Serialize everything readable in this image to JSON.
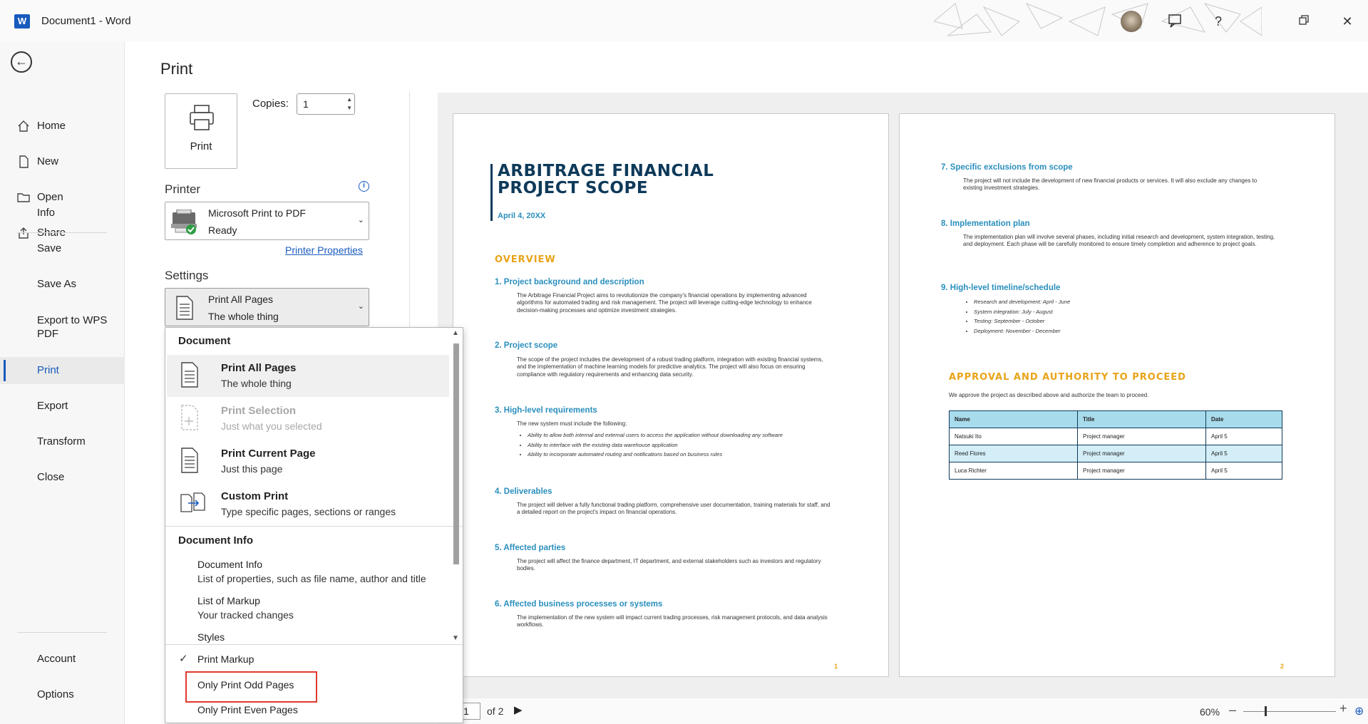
{
  "window": {
    "app_letter": "W",
    "title": "Document1  -  Word",
    "help_label": "?",
    "close_label": "✕"
  },
  "nav": {
    "back_icon": "back-arrow-icon",
    "top_items": [
      {
        "label": "Home",
        "icon": "home-icon"
      },
      {
        "label": "New",
        "icon": "new-doc-icon"
      },
      {
        "label": "Open",
        "icon": "folder-icon"
      },
      {
        "label": "Share",
        "icon": "share-icon"
      }
    ],
    "mid_items": [
      "Info",
      "Save",
      "Save As",
      "Export to WPS PDF",
      "Print",
      "Export",
      "Transform",
      "Close"
    ],
    "active": "Print",
    "bottom_items": [
      "Account",
      "Options"
    ]
  },
  "print": {
    "heading": "Print",
    "print_button": "Print",
    "copies_label": "Copies:",
    "copies_value": "1",
    "printer_section": "Printer",
    "printer_name": "Microsoft Print to PDF",
    "printer_status": "Ready",
    "printer_properties": "Printer Properties",
    "settings_section": "Settings",
    "settings_value": "Print All Pages",
    "settings_sub": "The whole thing"
  },
  "dropdown": {
    "document_header": "Document",
    "options": [
      {
        "title": "Print All Pages",
        "sub": "The whole thing",
        "selected": true,
        "disabled": false
      },
      {
        "title": "Print Selection",
        "sub": "Just what you selected",
        "selected": false,
        "disabled": true
      },
      {
        "title": "Print Current Page",
        "sub": "Just this page",
        "selected": false,
        "disabled": false
      },
      {
        "title": "Custom Print",
        "sub": "Type specific pages, sections or ranges",
        "selected": false,
        "disabled": false
      }
    ],
    "info_header": "Document Info",
    "info_items": [
      {
        "title": "Document Info",
        "sub": "List of properties, such as file name, author and title"
      },
      {
        "title": "List of Markup",
        "sub": "Your tracked changes"
      },
      {
        "title": "Styles",
        "sub": ""
      }
    ],
    "toggles": [
      {
        "label": "Print Markup",
        "checked": true
      },
      {
        "label": "Only Print Odd Pages",
        "checked": false
      },
      {
        "label": "Only Print Even Pages",
        "checked": false
      }
    ]
  },
  "preview": {
    "page1": {
      "title_line1": "ARBITRAGE FINANCIAL",
      "title_line2": "PROJECT SCOPE",
      "date": "April 4, 20XX",
      "overview": "OVERVIEW",
      "items": [
        {
          "heading": "1.  Project background and description",
          "text": "The Arbitrage Financial Project aims to revolutionize the company's financial operations by implementing advanced algorithms for automated trading and risk management. The project will leverage cutting-edge technology to enhance decision-making processes and optimize investment strategies."
        },
        {
          "heading": "2.  Project scope",
          "text": "The scope of the project includes the development of a robust trading platform, integration with existing financial systems, and the implementation of machine learning models for predictive analytics. The project will also focus on ensuring compliance with regulatory requirements and enhancing data security."
        },
        {
          "heading": "3.  High-level requirements",
          "text": "The new system must include the following:"
        },
        {
          "heading": "4.  Deliverables",
          "text": "The project will deliver a fully functional trading platform, comprehensive user documentation, training materials for staff, and a detailed report on the project's impact on financial operations."
        },
        {
          "heading": "5.   Affected parties",
          "text": "The project will affect the finance department, IT department, and external stakeholders such as investors and regulatory bodies."
        },
        {
          "heading": "6.  Affected business processes or systems",
          "text": "The implementation of the new system will impact current trading processes, risk management protocols, and data analysis workflows."
        }
      ],
      "requirements": [
        "Ability to allow both internal and external users to access the application without downloading any software",
        "Ability to interface with the existing data warehouse application",
        "Ability to incorporate automated routing and notifications based on business rules"
      ],
      "page_number": "1"
    },
    "page2": {
      "items": [
        {
          "heading": "7.  Specific exclusions from scope",
          "text": "The project will not include the development of new financial products or services. It will also exclude any changes to existing investment strategies."
        },
        {
          "heading": "8.  Implementation plan",
          "text": "The implementation plan will involve several phases, including initial research and development, system integration, testing, and deployment. Each phase will be carefully monitored to ensure timely completion and adherence to project goals."
        },
        {
          "heading": "9.  High-level timeline/schedule",
          "text": ""
        }
      ],
      "timeline": [
        "Research and development: April - June",
        "System integration: July - August",
        "Testing: September - October",
        "Deployment: November - December"
      ],
      "approval_heading": "APPROVAL AND AUTHORITY TO PROCEED",
      "approval_text": "We approve the project as described above and authorize the team to proceed.",
      "table_headers": [
        "Name",
        "Title",
        "Date"
      ],
      "table_rows": [
        [
          "Natsuki Ito",
          "Project manager",
          "April 5"
        ],
        [
          "Reed Flores",
          "Project manager",
          "April 5"
        ],
        [
          "Luca Richter",
          "Project manager",
          "April 5"
        ]
      ],
      "page_number": "2"
    }
  },
  "statusbar": {
    "current_page": "1",
    "of_pages": "of 2",
    "zoom": "60%",
    "zoom_minus": "–",
    "zoom_plus": "+"
  },
  "colors": {
    "accent": "#185abd",
    "doc_navy": "#0e3a5a",
    "doc_blue": "#2a8fbd",
    "doc_gold": "#e8a317",
    "highlight_red": "#e03a2e"
  }
}
